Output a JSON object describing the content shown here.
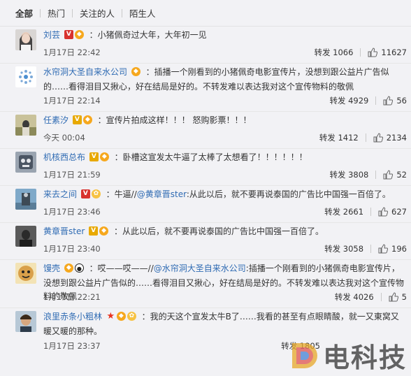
{
  "tabs": [
    "全部",
    "热门",
    "关注的人",
    "陌生人"
  ],
  "comments": [
    {
      "author": "刘芸",
      "text": "：小猪佩奇过大年，大年初一见",
      "time": "1月17日 22:42",
      "repost": "转发 1066",
      "likes": "11627"
    },
    {
      "author": "水帘洞大圣自来水公司",
      "text": "：插播一个刚看到的小猪佩奇电影宣传片，没想到跟公益片广告似的……看得泪目又揪心，好在结局是好的。不转发难以表达我对这个宣传物料的敬佩",
      "time": "1月17日 22:14",
      "repost": "转发 4929",
      "likes": "56"
    },
    {
      "author": "任素汐",
      "text": "：宣传片拍成这样！！！ 怒购影票！！！",
      "time": "今天 00:04",
      "repost": "转发 1412",
      "likes": "2134"
    },
    {
      "author": "机核西总布",
      "text": "：卧槽这宣发太牛逼了太棒了太想看了！！！！！！",
      "time": "1月17日 21:59",
      "repost": "转发 3808",
      "likes": "52"
    },
    {
      "author": "来去之间",
      "text_pre": "：牛逼//",
      "mention": "@黄章晋ster",
      "text_post": ":从此以后，就不要再说泰国的广告比中国强一百倍了。",
      "time": "1月17日 23:46",
      "repost": "转发 2661",
      "likes": "627"
    },
    {
      "author": "黄章晋ster",
      "text": "：从此以后，就不要再说泰国的广告比中国强一百倍了。",
      "time": "1月17日 23:40",
      "repost": "转发 3058",
      "likes": "196"
    },
    {
      "author": "馒壳",
      "text_pre": "：哎——哎——//",
      "mention": "@水帘洞大圣自来水公司",
      "text_post": ":插播一个刚看到的小猪佩奇电影宣传片，没想到跟公益片广告似的……看得泪目又揪心，好在结局是好的。不转发难以表达我对这个宣传物料的敬佩",
      "time": "1月17日 22:21",
      "repost": "转发 4026",
      "likes": "5"
    },
    {
      "author": "浪里赤条小粗林",
      "text": "：我的天这个宣发太牛B了……我看的甚至有点眼睛酸，就一又東窝又暖又暖的那种。",
      "time": "1月17日 23:37",
      "repost": "转发 1805",
      "likes": ""
    }
  ],
  "watermark": "电科技"
}
